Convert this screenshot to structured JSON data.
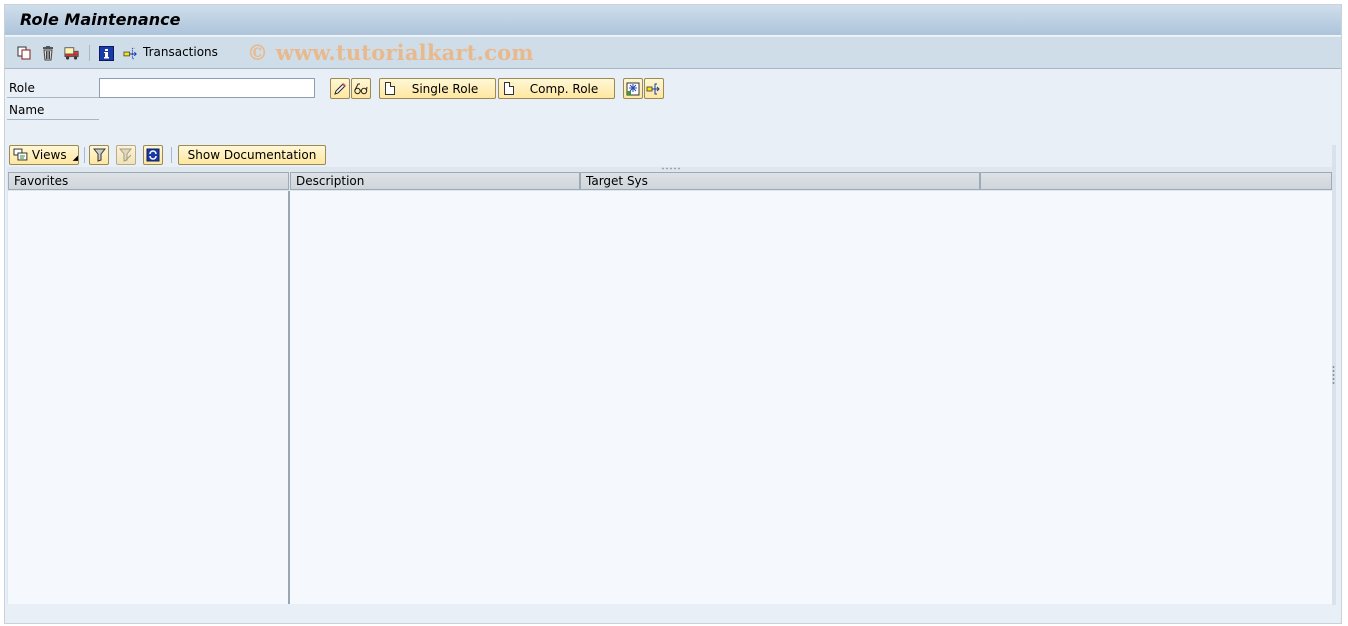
{
  "window": {
    "title": "Role Maintenance"
  },
  "app_toolbar": {
    "icons": [
      {
        "name": "copy-icon",
        "tooltip": "Copy"
      },
      {
        "name": "delete-icon",
        "tooltip": "Delete"
      },
      {
        "name": "transport-icon",
        "tooltip": "Transport"
      },
      {
        "name": "info-icon",
        "tooltip": "Information"
      },
      {
        "name": "transactions-icon",
        "tooltip": "Transactions"
      }
    ],
    "transactions_label": "Transactions",
    "watermark": "© www.tutorialkart.com"
  },
  "form": {
    "role_label": "Role",
    "role_value": "",
    "name_label": "Name",
    "buttons": {
      "change_icon": "pencil-icon",
      "display_icon": "glasses-icon",
      "single_role_label": "Single Role",
      "comp_role_label": "Comp. Role",
      "mass_icon": "mass-generation-icon",
      "navigate_icon": "transactions-icon"
    }
  },
  "tree_toolbar": {
    "views_label": "Views",
    "show_documentation_label": "Show Documentation"
  },
  "grid": {
    "columns": [
      "Favorites",
      "Description",
      "Target Sys",
      ""
    ],
    "rows": []
  },
  "colors": {
    "titlebar": "#adc4dc",
    "toolbar": "#cfdde8",
    "background": "#e8eff6",
    "button_yellow": "#ffe7a0",
    "watermark": "#e9b98e"
  }
}
